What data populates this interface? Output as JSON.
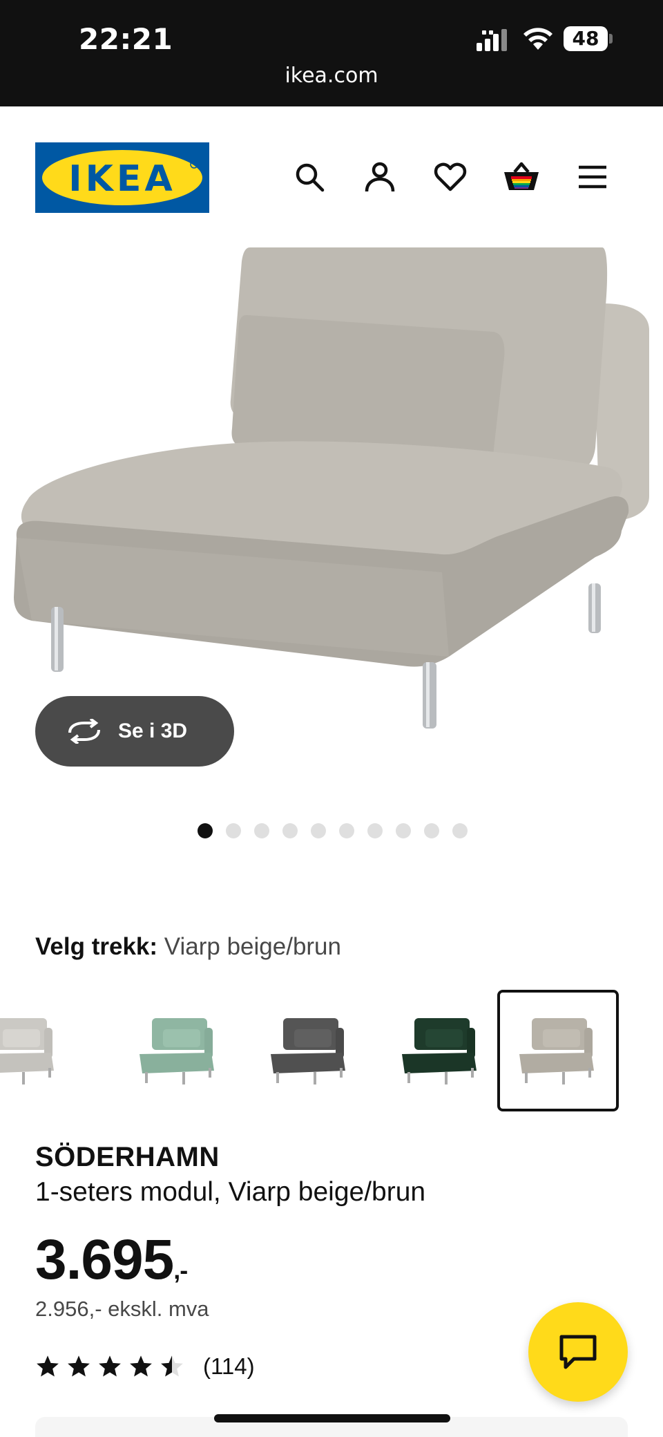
{
  "status_bar": {
    "time": "22:21",
    "battery": "48",
    "url": "ikea.com"
  },
  "header": {
    "logo_text": "IKEA",
    "icons": [
      "search-icon",
      "profile-icon",
      "heart-icon",
      "basket-icon",
      "menu-icon"
    ]
  },
  "gallery": {
    "view_3d_label": "Se i 3D",
    "dot_count": 10,
    "active_dot": 0
  },
  "cover": {
    "label": "Velg trekk:",
    "value": "Viarp beige/brun",
    "swatches": [
      {
        "name": "light-grey",
        "color": "#cbc9c4"
      },
      {
        "name": "green",
        "color": "#8fb6a2"
      },
      {
        "name": "dark-grey",
        "color": "#555555"
      },
      {
        "name": "dark-green",
        "color": "#1e3b2b"
      },
      {
        "name": "viarp-beige-brown",
        "color": "#b7b2a8",
        "selected": true
      }
    ]
  },
  "product": {
    "name": "SÖDERHAMN",
    "description": "1-seters modul, Viarp beige/brun",
    "price": "3.695",
    "price_suffix": ",-",
    "price_ex_vat": "2.956,- ekskl. mva",
    "rating": 4.5,
    "rating_count": "(114)"
  },
  "colors": {
    "ikea_blue": "#0058a3",
    "ikea_yellow": "#ffda1a",
    "fabric": "#b7b2a8"
  }
}
